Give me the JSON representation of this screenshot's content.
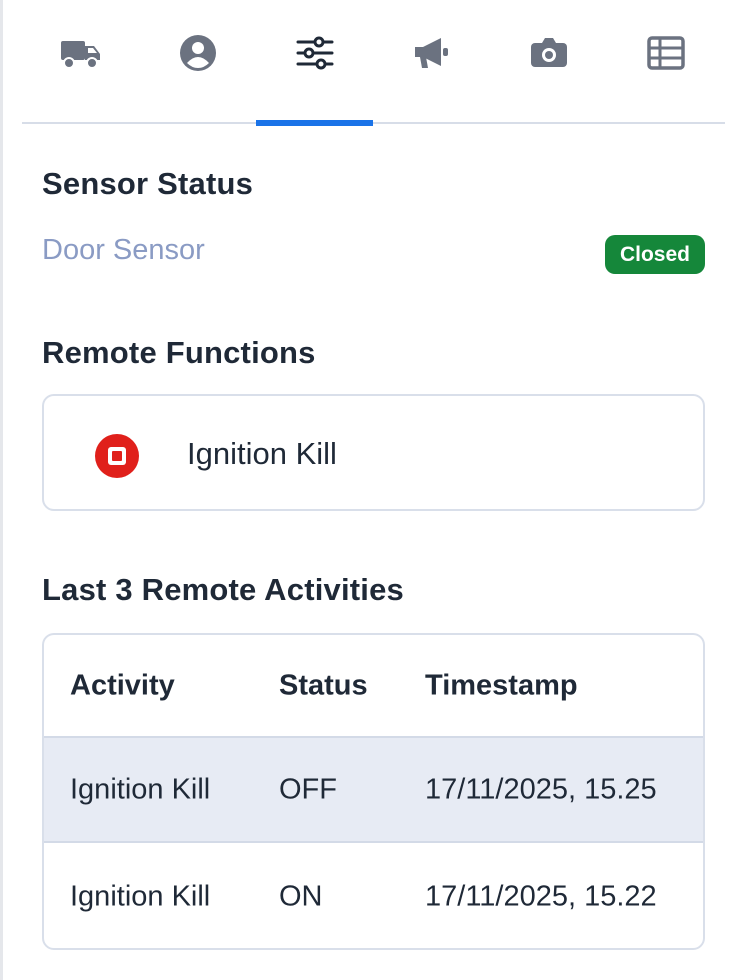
{
  "tabs": [
    {
      "icon": "truck-icon",
      "active": false
    },
    {
      "icon": "user-icon",
      "active": false
    },
    {
      "icon": "sliders-icon",
      "active": true
    },
    {
      "icon": "megaphone-icon",
      "active": false
    },
    {
      "icon": "camera-icon",
      "active": false
    },
    {
      "icon": "table-icon",
      "active": false
    }
  ],
  "sensor_status": {
    "title": "Sensor Status",
    "door_sensor_label": "Door Sensor",
    "door_sensor_value": "Closed"
  },
  "remote_functions": {
    "title": "Remote Functions",
    "items": [
      {
        "label": "Ignition Kill",
        "icon": "stop-circle-icon"
      }
    ]
  },
  "activities": {
    "title": "Last 3 Remote Activities",
    "columns": [
      "Activity",
      "Status",
      "Timestamp"
    ],
    "rows": [
      {
        "activity": "Ignition Kill",
        "status": "OFF",
        "timestamp": "17/11/2025, 15.25"
      },
      {
        "activity": "Ignition Kill",
        "status": "ON",
        "timestamp": "17/11/2025, 15.22"
      }
    ]
  },
  "colors": {
    "accent": "#1a73e8",
    "badge_closed": "#15873a",
    "stop_red": "#e0201b",
    "icon_gray": "#6b7280",
    "muted_label": "#8a9bc4"
  }
}
